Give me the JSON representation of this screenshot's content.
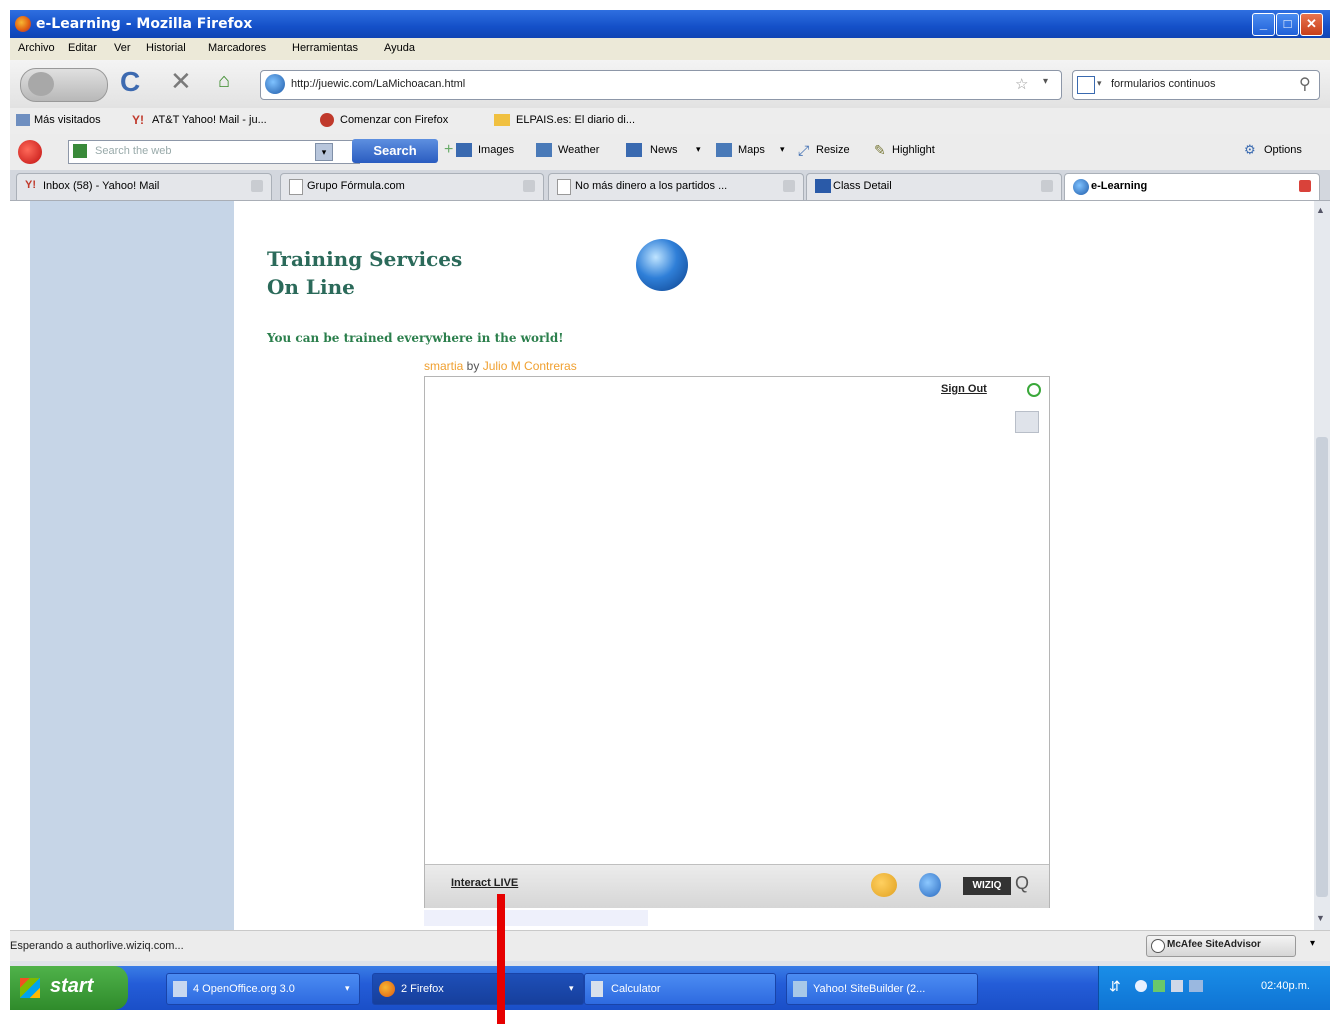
{
  "window": {
    "title": "e-Learning - Mozilla Firefox"
  },
  "menu": [
    "Archivo",
    "Editar",
    "Ver",
    "Historial",
    "Marcadores",
    "Herramientas",
    "Ayuda"
  ],
  "nav": {
    "url": "http://juewic.com/LaMichoacan.html",
    "search_value": "formularios continuos"
  },
  "bookmarks": [
    "Más visitados",
    "AT&T Yahoo! Mail - ju...",
    "Comenzar con Firefox",
    "ELPAIS.es: El diario di..."
  ],
  "toolbar": {
    "search_placeholder": "Search the web",
    "search_button": "Search",
    "items": [
      "Images",
      "Weather",
      "News",
      "Maps",
      "Resize",
      "Highlight"
    ],
    "options": "Options"
  },
  "tabs": [
    "Inbox (58) - Yahoo! Mail",
    "Grupo Fórmula.com",
    "No más dinero a los partidos ...",
    "Class Detail",
    "e-Learning"
  ],
  "page": {
    "heading_line1": "Training Services",
    "heading_line2": "On Line",
    "tagline": "You can be trained everywhere in the world!",
    "credit_prefix": "smartia",
    "credit_by": " by ",
    "credit_author": "Julio M Contreras",
    "widget": {
      "sign_out": "Sign Out",
      "interact": "Interact LIVE",
      "brand": "WIZIQ"
    }
  },
  "status": {
    "text": "Esperando a authorlive.wiziq.com...",
    "addon": "McAfee SiteAdvisor"
  },
  "taskbar": {
    "start": "start",
    "buttons": [
      "4 OpenOffice.org 3.0",
      "2 Firefox",
      "Calculator",
      "Yahoo! SiteBuilder (2..."
    ],
    "clock": "02:40p.m."
  },
  "colors": {
    "heading": "#2b6a5a",
    "tagline": "#2b7f4c",
    "credit": "#f0a030",
    "arrow": "#e60000"
  }
}
